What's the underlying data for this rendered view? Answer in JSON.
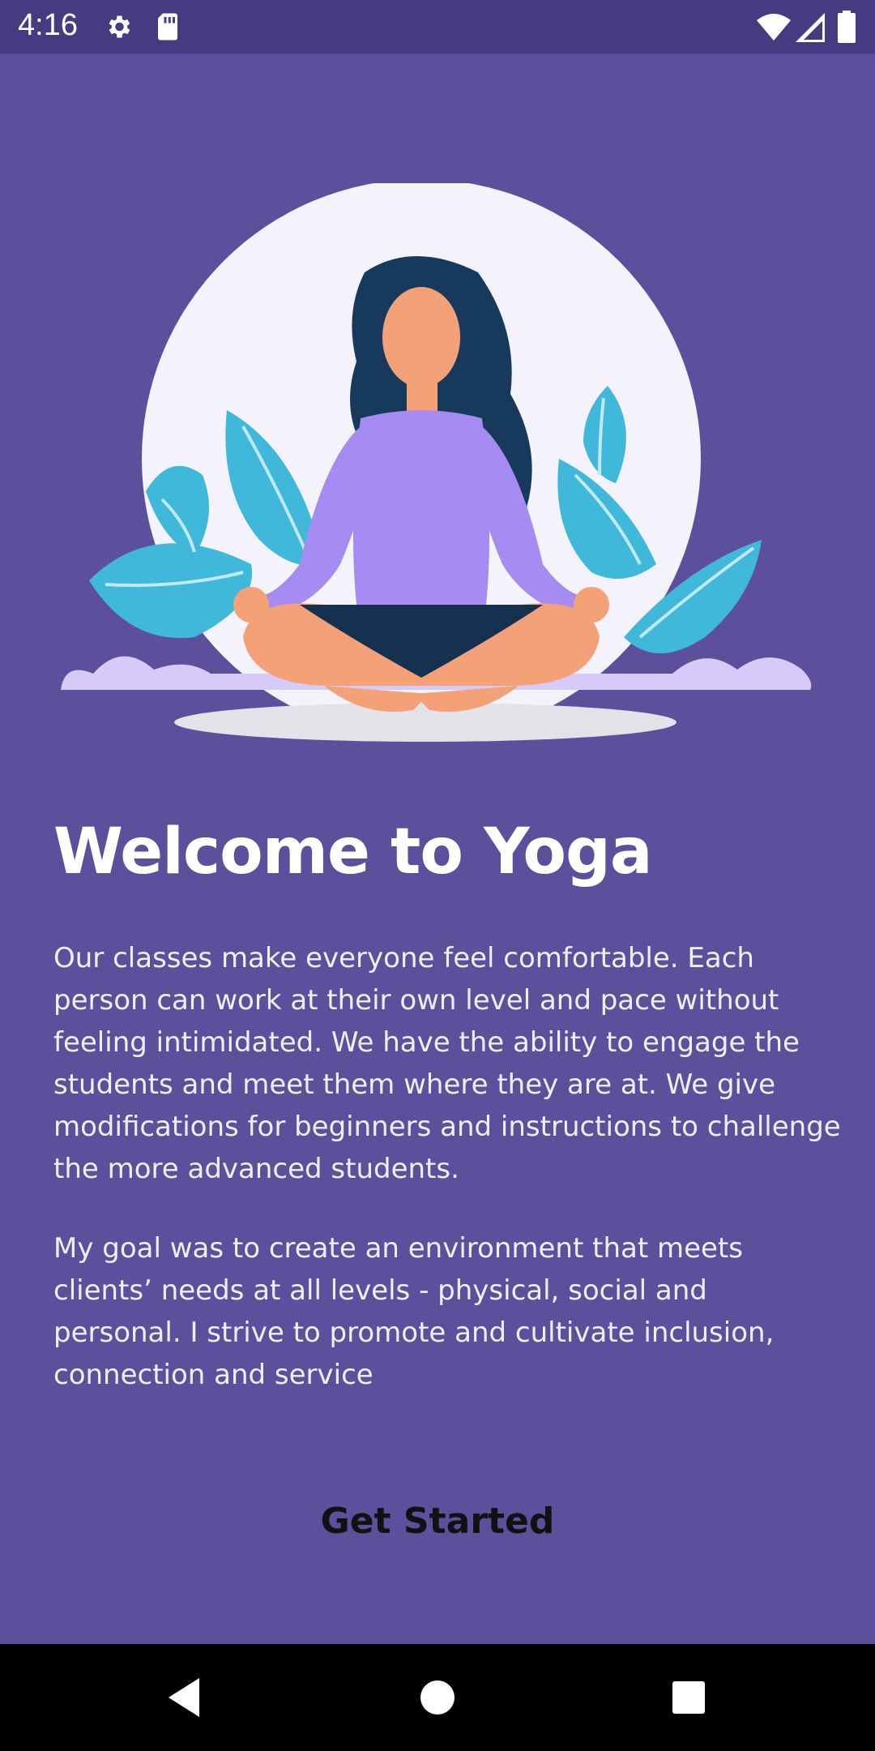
{
  "status_bar": {
    "time": "4:16",
    "left_icons": [
      "gear-icon",
      "sd-card-icon"
    ],
    "right_icons": [
      "wifi-icon",
      "signal-icon",
      "battery-icon"
    ]
  },
  "colors": {
    "background": "#5e4f9c",
    "status_bar": "#483a80",
    "title": "#ffffff",
    "body_text": "#f1eefb",
    "button_text": "#111111",
    "nav_bar": "#000000"
  },
  "main": {
    "illustration_icon": "yoga-meditation-illustration",
    "title": "Welcome to Yoga",
    "paragraph1_lines": [
      "Our classes make everyone feel comfortable. Each",
      "person can work at their own level and pace without",
      "feeling intimidated. We have the ability to engage the",
      "students and meet them where they are at. We give",
      "modifications for beginners and instructions to challenge",
      "the more advanced students."
    ],
    "paragraph2_lines": [
      "My goal was to create an environment that meets",
      "clients’ needs at all levels - physical, social and",
      "personal. I strive to promote and cultivate inclusion,",
      "connection and service"
    ],
    "button_label": "Get Started"
  },
  "nav_bar": {
    "icons": [
      "back-icon",
      "home-icon",
      "recents-icon"
    ]
  }
}
